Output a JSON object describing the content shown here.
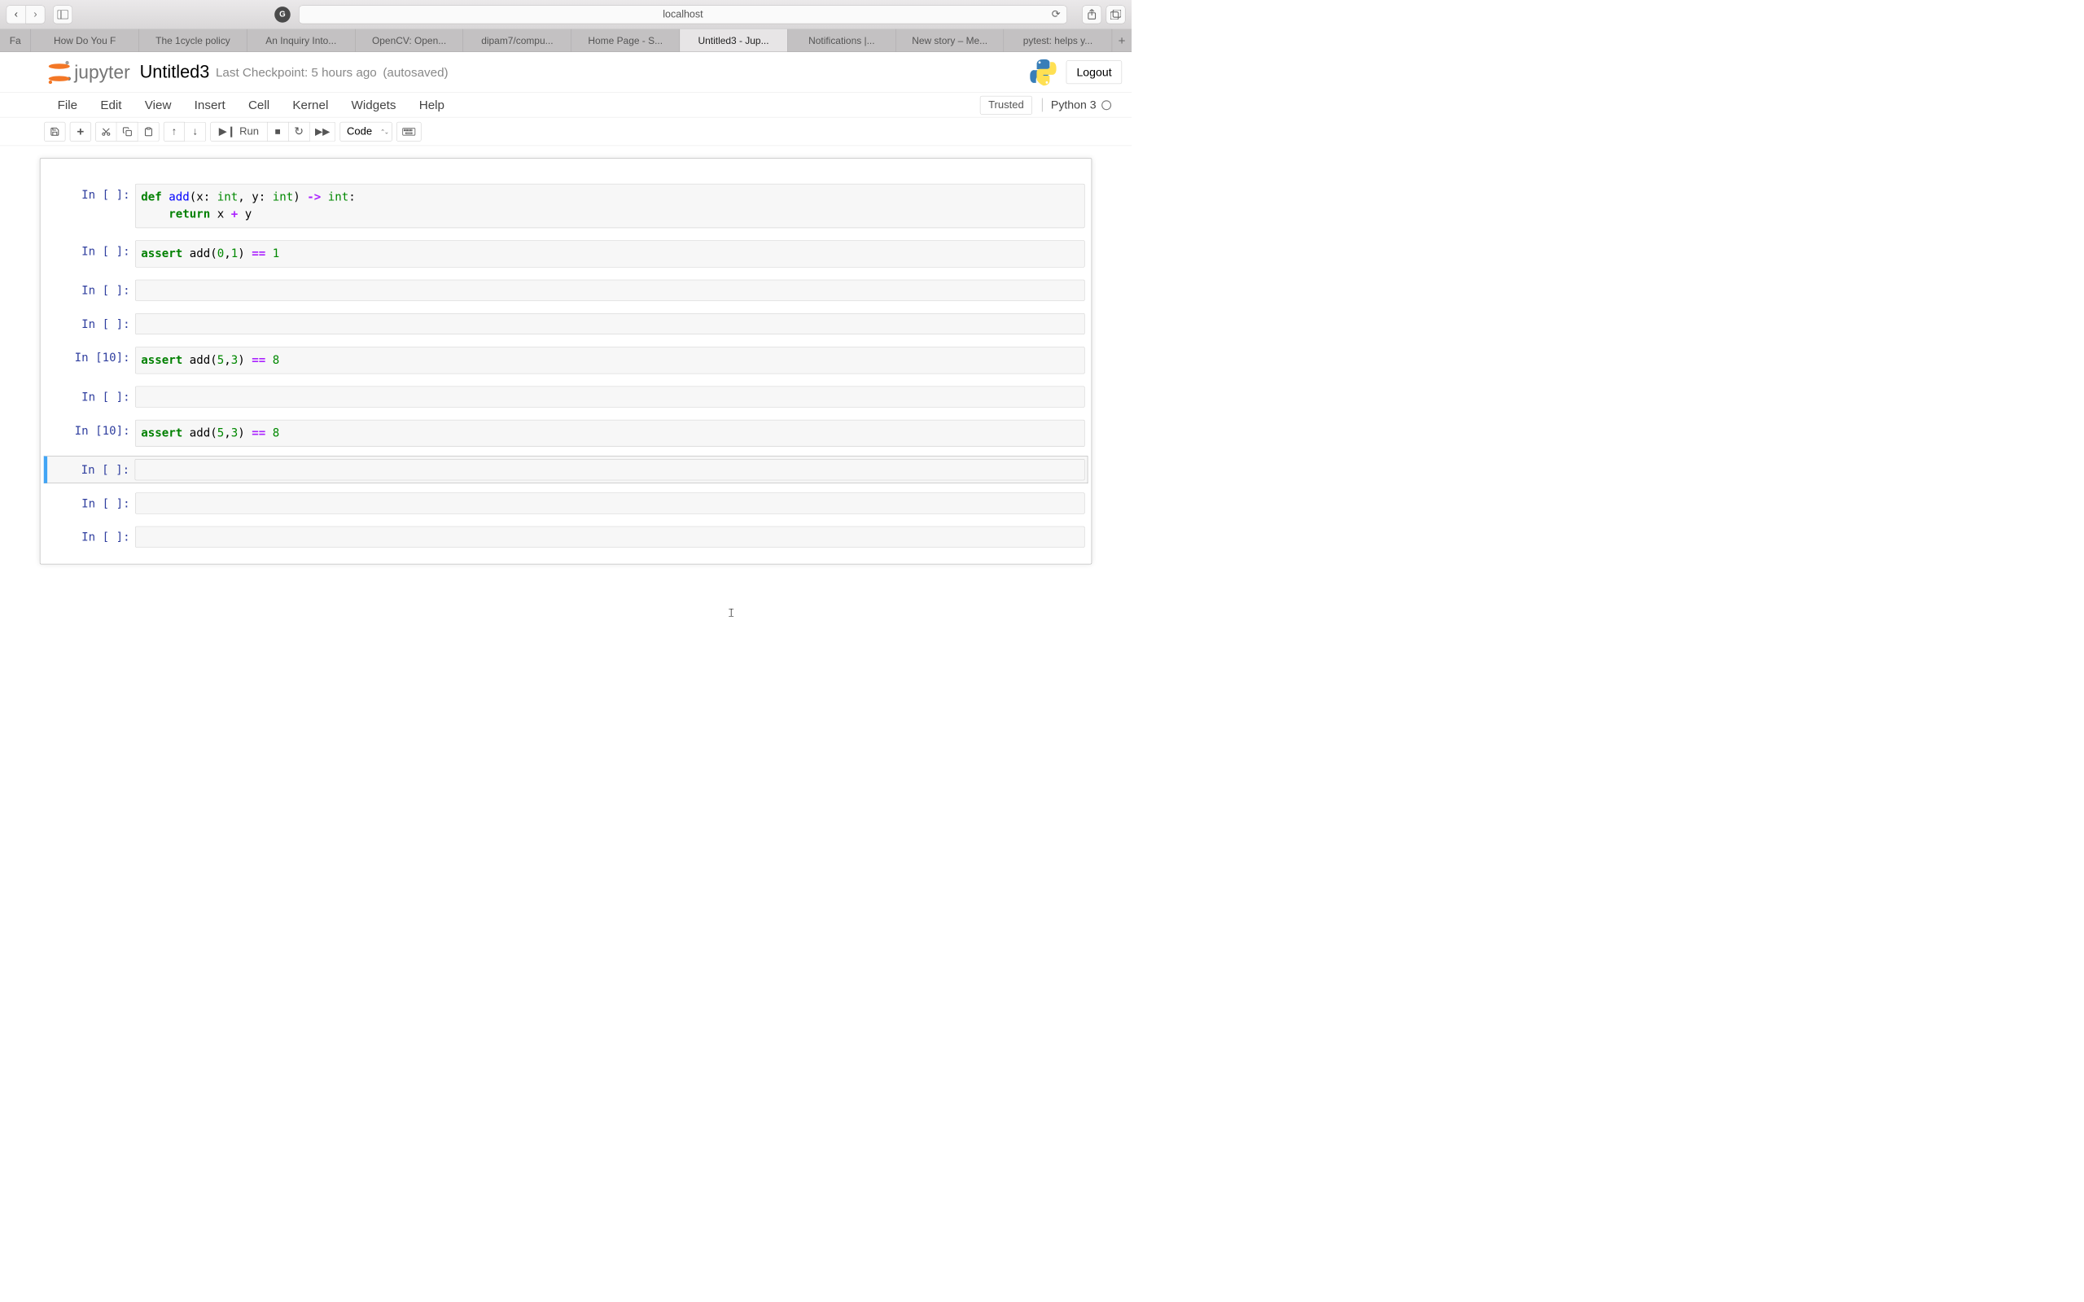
{
  "browser": {
    "url": "localhost",
    "tabs": [
      {
        "label": "Fa",
        "short": true
      },
      {
        "label": "How Do You F"
      },
      {
        "label": "The 1cycle policy"
      },
      {
        "label": "An Inquiry Into..."
      },
      {
        "label": "OpenCV: Open..."
      },
      {
        "label": "dipam7/compu..."
      },
      {
        "label": "Home Page - S..."
      },
      {
        "label": "Untitled3 - Jup...",
        "active": true
      },
      {
        "label": "Notifications |..."
      },
      {
        "label": "New story – Me..."
      },
      {
        "label": "pytest: helps y..."
      }
    ]
  },
  "header": {
    "logo_text": "jupyter",
    "title": "Untitled3",
    "checkpoint": "Last Checkpoint: 5 hours ago",
    "autosave": "(autosaved)",
    "logout": "Logout"
  },
  "menubar": {
    "items": [
      "File",
      "Edit",
      "View",
      "Insert",
      "Cell",
      "Kernel",
      "Widgets",
      "Help"
    ],
    "trusted": "Trusted",
    "kernel": "Python 3"
  },
  "toolbar": {
    "run_label": "Run",
    "cell_type": "Code"
  },
  "cells": [
    {
      "prompt": "In [ ]:",
      "tokens": [
        {
          "t": "def ",
          "c": "kw"
        },
        {
          "t": "add",
          "c": "fn"
        },
        {
          "t": "(x: ",
          "c": "pl"
        },
        {
          "t": "int",
          "c": "ty"
        },
        {
          "t": ", y: ",
          "c": "pl"
        },
        {
          "t": "int",
          "c": "ty"
        },
        {
          "t": ") ",
          "c": "pl"
        },
        {
          "t": "->",
          "c": "op"
        },
        {
          "t": " ",
          "c": "pl"
        },
        {
          "t": "int",
          "c": "ty"
        },
        {
          "t": ":",
          "c": "pl"
        },
        {
          "t": "\n    ",
          "c": "pl"
        },
        {
          "t": "return",
          "c": "kw"
        },
        {
          "t": " x ",
          "c": "pl"
        },
        {
          "t": "+",
          "c": "op"
        },
        {
          "t": " y",
          "c": "pl"
        }
      ]
    },
    {
      "prompt": "In [ ]:",
      "tokens": [
        {
          "t": "assert",
          "c": "kw"
        },
        {
          "t": " add(",
          "c": "pl"
        },
        {
          "t": "0",
          "c": "num"
        },
        {
          "t": ",",
          "c": "pl"
        },
        {
          "t": "1",
          "c": "num"
        },
        {
          "t": ") ",
          "c": "pl"
        },
        {
          "t": "==",
          "c": "op"
        },
        {
          "t": " ",
          "c": "pl"
        },
        {
          "t": "1",
          "c": "num"
        }
      ]
    },
    {
      "prompt": "In [ ]:",
      "tokens": []
    },
    {
      "prompt": "In [ ]:",
      "tokens": []
    },
    {
      "prompt": "In [10]:",
      "tokens": [
        {
          "t": "assert",
          "c": "kw"
        },
        {
          "t": " add(",
          "c": "pl"
        },
        {
          "t": "5",
          "c": "num"
        },
        {
          "t": ",",
          "c": "pl"
        },
        {
          "t": "3",
          "c": "num"
        },
        {
          "t": ") ",
          "c": "pl"
        },
        {
          "t": "==",
          "c": "op"
        },
        {
          "t": " ",
          "c": "pl"
        },
        {
          "t": "8",
          "c": "num"
        }
      ]
    },
    {
      "prompt": "In [ ]:",
      "tokens": []
    },
    {
      "prompt": "In [10]:",
      "tokens": [
        {
          "t": "assert",
          "c": "kw"
        },
        {
          "t": " add(",
          "c": "pl"
        },
        {
          "t": "5",
          "c": "num"
        },
        {
          "t": ",",
          "c": "pl"
        },
        {
          "t": "3",
          "c": "num"
        },
        {
          "t": ") ",
          "c": "pl"
        },
        {
          "t": "==",
          "c": "op"
        },
        {
          "t": " ",
          "c": "pl"
        },
        {
          "t": "8",
          "c": "num"
        }
      ]
    },
    {
      "prompt": "In [ ]:",
      "tokens": [],
      "selected": true
    },
    {
      "prompt": "In [ ]:",
      "tokens": []
    },
    {
      "prompt": "In [ ]:",
      "tokens": []
    }
  ]
}
